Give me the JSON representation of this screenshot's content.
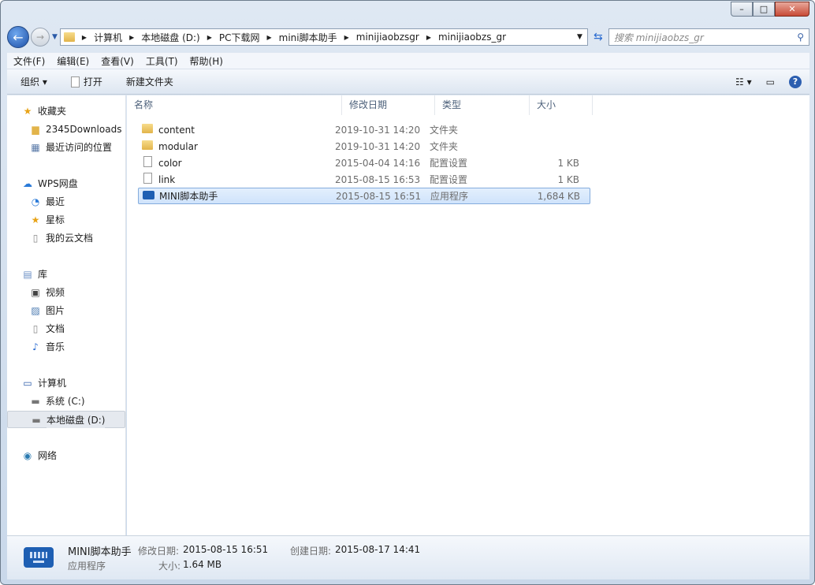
{
  "window": {
    "minimize": "–",
    "maximize": "□",
    "close": "✕"
  },
  "address": {
    "crumbs": [
      "计算机",
      "本地磁盘 (D:)",
      "PC下载网",
      "mini脚本助手",
      "minijiaobzsgr",
      "minijiaobzs_gr"
    ]
  },
  "search": {
    "placeholder": "搜索 minijiaobzs_gr"
  },
  "menu": [
    "文件(F)",
    "编辑(E)",
    "查看(V)",
    "工具(T)",
    "帮助(H)"
  ],
  "toolbar": {
    "organize": "组织 ▾",
    "open": "打开",
    "new_folder": "新建文件夹"
  },
  "sidebar": [
    {
      "label": "收藏夹",
      "icon": "star-icon"
    },
    {
      "label": "2345Downloads",
      "icon": "folder-icon"
    },
    {
      "label": "最近访问的位置",
      "icon": "recent-places-icon"
    },
    {
      "label": "WPS网盘",
      "icon": "cloud-icon"
    },
    {
      "label": "最近",
      "icon": "clock-icon"
    },
    {
      "label": "星标",
      "icon": "star-icon"
    },
    {
      "label": "我的云文档",
      "icon": "document-icon"
    },
    {
      "label": "库",
      "icon": "library-icon"
    },
    {
      "label": "视频",
      "icon": "video-icon"
    },
    {
      "label": "图片",
      "icon": "picture-icon"
    },
    {
      "label": "文档",
      "icon": "document-icon"
    },
    {
      "label": "音乐",
      "icon": "music-icon"
    },
    {
      "label": "计算机",
      "icon": "computer-icon"
    },
    {
      "label": "系统 (C:)",
      "icon": "drive-icon"
    },
    {
      "label": "本地磁盘 (D:)",
      "icon": "drive-icon"
    },
    {
      "label": "网络",
      "icon": "network-icon"
    }
  ],
  "columns": [
    "名称",
    "修改日期",
    "类型",
    "大小"
  ],
  "files": [
    {
      "name": "content",
      "date": "2019-10-31 14:20",
      "type": "文件夹",
      "size": "",
      "icon": "folder"
    },
    {
      "name": "modular",
      "date": "2019-10-31 14:20",
      "type": "文件夹",
      "size": "",
      "icon": "folder"
    },
    {
      "name": "color",
      "date": "2015-04-04 14:16",
      "type": "配置设置",
      "size": "1 KB",
      "icon": "cfg"
    },
    {
      "name": "link",
      "date": "2015-08-15 16:53",
      "type": "配置设置",
      "size": "1 KB",
      "icon": "cfg"
    },
    {
      "name": "MINI脚本助手",
      "date": "2015-08-15 16:51",
      "type": "应用程序",
      "size": "1,684 KB",
      "icon": "app"
    }
  ],
  "status": {
    "name": "MINI脚本助手",
    "type": "应用程序",
    "modified_label": "修改日期:",
    "modified": "2015-08-15 16:51",
    "created_label": "创建日期:",
    "created": "2015-08-17 14:41",
    "size_label": "大小:",
    "size": "1.64 MB"
  }
}
